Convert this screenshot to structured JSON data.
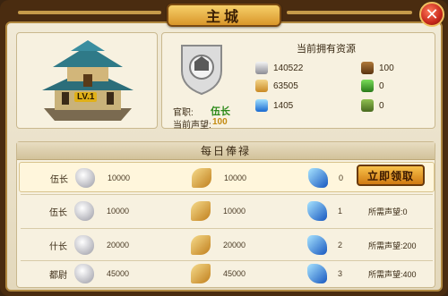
{
  "window": {
    "title": "主城",
    "close_icon": "close-icon"
  },
  "building": {
    "level_tag": "LV.1",
    "icon": "palace-icon"
  },
  "resources": {
    "header": "当前拥有资源",
    "badge_icon": "official-badge-icon",
    "official_label": "官职:",
    "official_value": "伍长",
    "reputation_label": "当前声望:",
    "reputation_value": "100",
    "items": [
      {
        "icon": "silver-icon",
        "value": "140522"
      },
      {
        "icon": "grain-icon",
        "value": "63505"
      },
      {
        "icon": "gem-icon",
        "value": "1405"
      },
      {
        "icon": "bag-icon",
        "value": "100"
      },
      {
        "icon": "herb-icon",
        "value": "0"
      },
      {
        "icon": "leaf-icon",
        "value": "0"
      }
    ]
  },
  "salary": {
    "header": "每日俸禄",
    "claim_label": "立即领取",
    "rows": [
      {
        "rank": "伍长",
        "silver": "10000",
        "grain": "10000",
        "gem": "0",
        "req": ""
      },
      {
        "rank": "伍长",
        "silver": "10000",
        "grain": "10000",
        "gem": "1",
        "req": "所需声望:0"
      },
      {
        "rank": "什长",
        "silver": "20000",
        "grain": "20000",
        "gem": "2",
        "req": "所需声望:200"
      },
      {
        "rank": "都尉",
        "silver": "45000",
        "grain": "45000",
        "gem": "3",
        "req": "所需声望:400"
      }
    ]
  },
  "colors": {
    "frame": "#4a2c10",
    "panel": "#f1ead7",
    "accent_gold": "#e0a830",
    "rank_green": "#2d8a1a"
  }
}
